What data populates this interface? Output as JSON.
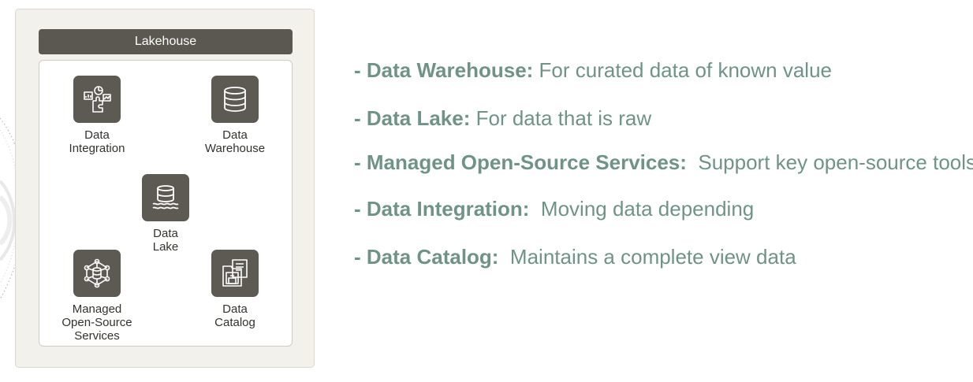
{
  "lakehouse": {
    "title": "Lakehouse",
    "components": [
      {
        "id": "data-integration",
        "label": [
          "Data",
          "Integration"
        ],
        "icon": "puzzle-chart-icon"
      },
      {
        "id": "data-warehouse",
        "label": [
          "Data",
          "Warehouse"
        ],
        "icon": "database-icon"
      },
      {
        "id": "data-lake",
        "label": [
          "Data",
          "Lake"
        ],
        "icon": "database-waves-icon"
      },
      {
        "id": "managed-open-source",
        "label": [
          "Managed",
          "Open-Source",
          "Services"
        ],
        "icon": "network-hub-icon"
      },
      {
        "id": "data-catalog",
        "label": [
          "Data",
          "Catalog"
        ],
        "icon": "catalog-folder-icon"
      }
    ]
  },
  "bullets": [
    {
      "dash": "- ",
      "term": "Data Warehouse:",
      "desc": "For curated data of known value"
    },
    {
      "dash": "- ",
      "term": "Data Lake:",
      "desc": "For data that is raw"
    },
    {
      "dash": "- ",
      "term": "Managed Open-Source Services:",
      "desc": "Support key open-source tools"
    },
    {
      "dash": "- ",
      "term": "Data Integration:",
      "desc": "Moving data depending"
    },
    {
      "dash": "- ",
      "term": "Data Catalog:",
      "desc": "Maintains a complete view data"
    }
  ],
  "colors": {
    "accent_text": "#6f9387",
    "icon_box": "#5d5a54",
    "header_bar": "#5b5852",
    "panel_bg": "#f3f1ec"
  }
}
